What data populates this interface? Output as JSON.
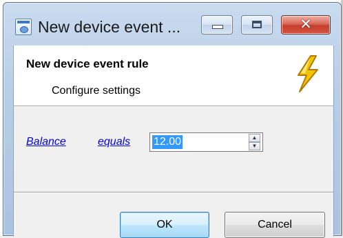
{
  "window": {
    "title": "New device event ...",
    "icon": "app-window-icon",
    "controls": {
      "minimize_icon": "minimize-icon",
      "maximize_icon": "maximize-icon",
      "close_icon": "close-icon",
      "close_glyph": "✕"
    }
  },
  "header": {
    "title": "New device event rule",
    "subtitle": "Configure settings",
    "icon": "lightning-icon"
  },
  "rule": {
    "field_link": "Balance",
    "operator_link": "equals",
    "value": "12.00",
    "spin_up_glyph": "▲",
    "spin_down_glyph": "▼"
  },
  "buttons": {
    "ok_label": "OK",
    "cancel_label": "Cancel"
  },
  "colors": {
    "selection": "#3399ff",
    "link": "#0000ee",
    "close_button": "#c43f2e",
    "lightning": "#f5c400"
  }
}
